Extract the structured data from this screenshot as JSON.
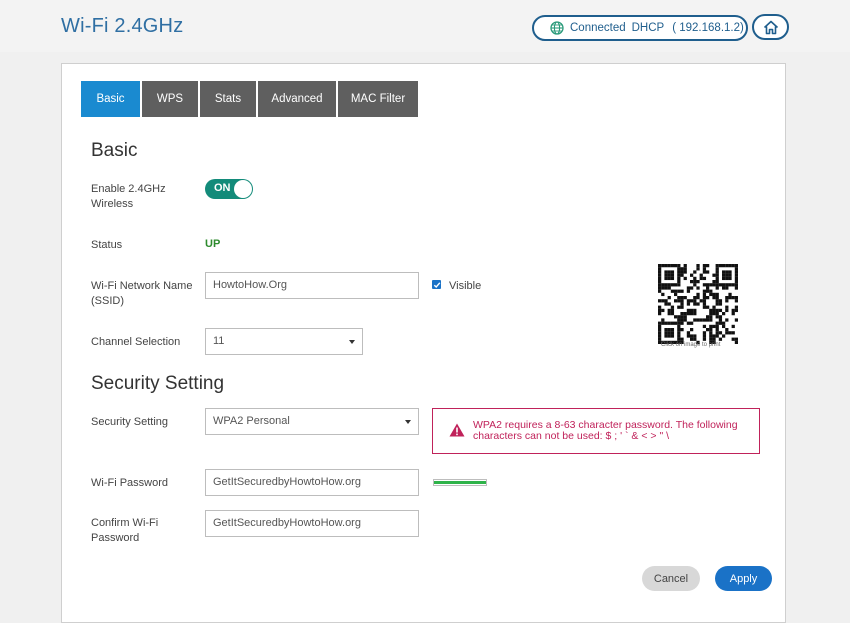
{
  "header": {
    "title": "Wi-Fi 2.4GHz",
    "connection": {
      "status": "Connected",
      "mode": "DHCP",
      "ip": "( 192.168.1.2)"
    },
    "home_icon": "home-icon",
    "globe_icon": "globe-icon"
  },
  "tabs": [
    {
      "label": "Basic",
      "active": true
    },
    {
      "label": "WPS",
      "active": false
    },
    {
      "label": "Stats",
      "active": false
    },
    {
      "label": "Advanced",
      "active": false
    },
    {
      "label": "MAC Filter",
      "active": false
    }
  ],
  "basic": {
    "heading": "Basic",
    "enable_label_line1": "Enable 2.4GHz",
    "enable_label_line2": "Wireless",
    "enable_toggle": "ON",
    "status_label": "Status",
    "status_value": "UP",
    "ssid_label_line1": "Wi-Fi Network Name",
    "ssid_label_line2": "(SSID)",
    "ssid_value": "HowtoHow.Org",
    "visible_label": "Visible",
    "visible_checked": true,
    "channel_label": "Channel Selection",
    "channel_value": "11",
    "qr_caption": "Click on image to print"
  },
  "security": {
    "heading": "Security Setting",
    "setting_label": "Security Setting",
    "setting_value": "WPA2 Personal",
    "alert_line1": "WPA2 requires a 8-63 character password. The following",
    "alert_line2": "characters can not be used: $ ; ' ` & < > \" \\",
    "password_label": "Wi-Fi Password",
    "password_value": "GetItSecuredbyHowtoHow.org",
    "confirm_label_line1": "Confirm Wi-Fi",
    "confirm_label_line2": "Password",
    "confirm_value": "GetItSecuredbyHowtoHow.org",
    "strength_level": 1.0,
    "strength_color": "#2eb34a"
  },
  "actions": {
    "cancel": "Cancel",
    "apply": "Apply"
  },
  "colors": {
    "accent": "#1a8ad0",
    "title": "#2f6fa3",
    "toggle_on": "#138b7a",
    "status_up": "#2e8b2e",
    "alert": "#c0225a",
    "apply": "#1a72c7"
  }
}
